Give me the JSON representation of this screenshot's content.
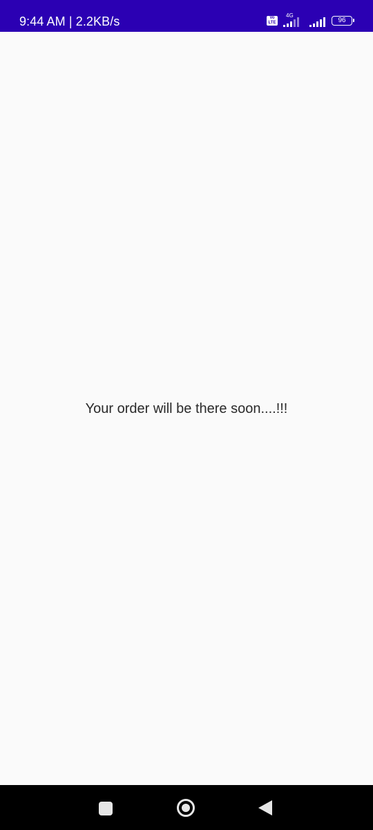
{
  "status_bar": {
    "time_speed": "9:44 AM | 2.2KB/s",
    "volte_label": "Vo LTE",
    "network_type": "4G",
    "battery_level": "96",
    "background_color": "#2b00b3"
  },
  "main": {
    "message": "Your order will be there soon....!!!"
  },
  "nav_bar": {
    "recents_icon": "square-recents-icon",
    "home_icon": "circle-home-icon",
    "back_icon": "triangle-back-icon"
  }
}
